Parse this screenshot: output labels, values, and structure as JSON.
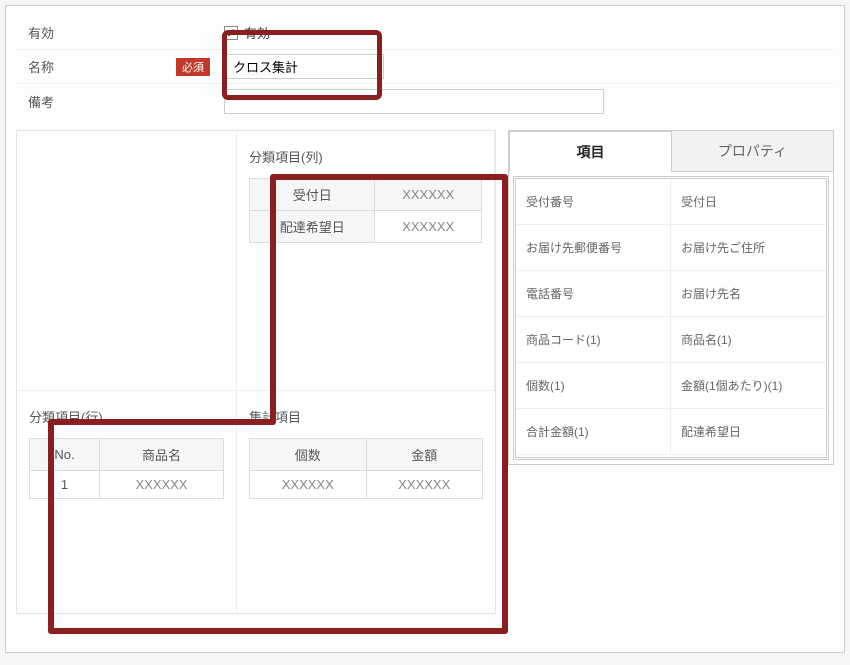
{
  "form": {
    "enabled_label": "有効",
    "enabled_checkbox_label": "有効",
    "enabled_checked": true,
    "name_label": "名称",
    "required_badge": "必須",
    "name_value": "クロス集計",
    "notes_label": "備考",
    "notes_value": ""
  },
  "sections": {
    "col_group_title": "分類項目(列)",
    "row_group_title": "分類項目(行)",
    "agg_title": "集計項目"
  },
  "col_group": {
    "headers": [
      "受付日",
      "XXXXXX"
    ],
    "rows": [
      [
        "配達希望日",
        "XXXXXX"
      ]
    ]
  },
  "row_group": {
    "headers": [
      "No.",
      "商品名"
    ],
    "rows": [
      [
        "1",
        "XXXXXX"
      ]
    ]
  },
  "agg": {
    "headers": [
      "個数",
      "金額"
    ],
    "rows": [
      [
        "XXXXXX",
        "XXXXXX"
      ]
    ]
  },
  "side_panel": {
    "tab_items": "項目",
    "tab_properties": "プロパティ",
    "items": [
      [
        "受付番号",
        "受付日"
      ],
      [
        "お届け先郵便番号",
        "お届け先ご住所"
      ],
      [
        "電話番号",
        "お届け先名"
      ],
      [
        "商品コード(1)",
        "商品名(1)"
      ],
      [
        "個数(1)",
        "金額(1個あたり)(1)"
      ],
      [
        "合計金額(1)",
        "配達希望日"
      ]
    ]
  },
  "colors": {
    "highlight": "#8b1e1e",
    "required": "#c0392b"
  }
}
